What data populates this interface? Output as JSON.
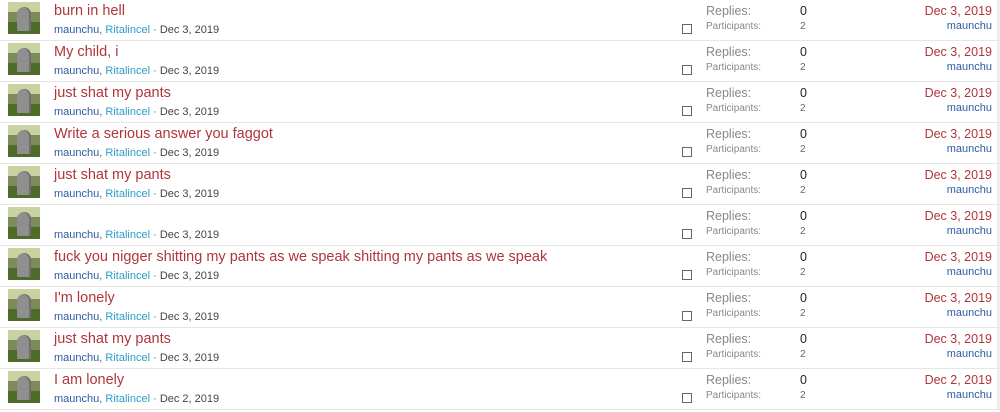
{
  "threads": [
    {
      "title": "burn in hell",
      "starter": "maunchu",
      "participant": "Ritalincel",
      "date": "Dec 3, 2019",
      "replies_label": "Replies:",
      "replies": "0",
      "participants_label": "Participants:",
      "participants": "2",
      "last_date": "Dec 3, 2019",
      "last_user": "maunchu"
    },
    {
      "title": "My child, i",
      "starter": "maunchu",
      "participant": "Ritalincel",
      "date": "Dec 3, 2019",
      "replies_label": "Replies:",
      "replies": "0",
      "participants_label": "Participants:",
      "participants": "2",
      "last_date": "Dec 3, 2019",
      "last_user": "maunchu"
    },
    {
      "title": "just shat my pants",
      "starter": "maunchu",
      "participant": "Ritalincel",
      "date": "Dec 3, 2019",
      "replies_label": "Replies:",
      "replies": "0",
      "participants_label": "Participants:",
      "participants": "2",
      "last_date": "Dec 3, 2019",
      "last_user": "maunchu"
    },
    {
      "title": "Write a serious answer you faggot",
      "starter": "maunchu",
      "participant": "Ritalincel",
      "date": "Dec 3, 2019",
      "replies_label": "Replies:",
      "replies": "0",
      "participants_label": "Participants:",
      "participants": "2",
      "last_date": "Dec 3, 2019",
      "last_user": "maunchu"
    },
    {
      "title": "just shat my pants",
      "starter": "maunchu",
      "participant": "Ritalincel",
      "date": "Dec 3, 2019",
      "replies_label": "Replies:",
      "replies": "0",
      "participants_label": "Participants:",
      "participants": "2",
      "last_date": "Dec 3, 2019",
      "last_user": "maunchu"
    },
    {
      "title": "",
      "starter": "maunchu",
      "participant": "Ritalincel",
      "date": "Dec 3, 2019",
      "replies_label": "Replies:",
      "replies": "0",
      "participants_label": "Participants:",
      "participants": "2",
      "last_date": "Dec 3, 2019",
      "last_user": "maunchu"
    },
    {
      "title": "fuck you nigger shitting my pants as we speak shitting my pants as we speak",
      "starter": "maunchu",
      "participant": "Ritalincel",
      "date": "Dec 3, 2019",
      "replies_label": "Replies:",
      "replies": "0",
      "participants_label": "Participants:",
      "participants": "2",
      "last_date": "Dec 3, 2019",
      "last_user": "maunchu"
    },
    {
      "title": "I'm lonely",
      "starter": "maunchu",
      "participant": "Ritalincel",
      "date": "Dec 3, 2019",
      "replies_label": "Replies:",
      "replies": "0",
      "participants_label": "Participants:",
      "participants": "2",
      "last_date": "Dec 3, 2019",
      "last_user": "maunchu"
    },
    {
      "title": "just shat my pants",
      "starter": "maunchu",
      "participant": "Ritalincel",
      "date": "Dec 3, 2019",
      "replies_label": "Replies:",
      "replies": "0",
      "participants_label": "Participants:",
      "participants": "2",
      "last_date": "Dec 3, 2019",
      "last_user": "maunchu"
    },
    {
      "title": "I am lonely",
      "starter": "maunchu",
      "participant": "Ritalincel",
      "date": "Dec 2, 2019",
      "replies_label": "Replies:",
      "replies": "0",
      "participants_label": "Participants:",
      "participants": "2",
      "last_date": "Dec 2, 2019",
      "last_user": "maunchu"
    }
  ]
}
